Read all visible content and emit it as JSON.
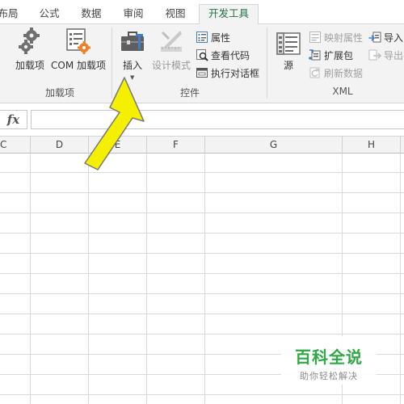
{
  "tabs": [
    {
      "label": "布局"
    },
    {
      "label": "公式"
    },
    {
      "label": "数据"
    },
    {
      "label": "审阅"
    },
    {
      "label": "视图"
    },
    {
      "label": "开发工具",
      "active": true
    }
  ],
  "ribbon": {
    "addins_group": {
      "label": "加载项",
      "addins_button": "加载项",
      "com_addins_button": "COM 加载项"
    },
    "controls_group": {
      "label": "控件",
      "insert_button": "插入",
      "design_mode_button": "设计模式",
      "properties_button": "属性",
      "view_code_button": "查看代码",
      "run_dialog_button": "执行对话框"
    },
    "xml_group": {
      "label": "XML",
      "source_button": "源",
      "map_properties_button": "映射属性",
      "expansion_pack_button": "扩展包",
      "refresh_data_button": "刷新数据",
      "import_button": "导入",
      "export_button": "导出"
    }
  },
  "formula_bar": {
    "fx_label": "fx",
    "value": ""
  },
  "columns": [
    "C",
    "D",
    "E",
    "F",
    "G",
    "H"
  ],
  "watermark": {
    "title": "百科全说",
    "subtitle": "助你轻松解决"
  },
  "colors": {
    "accent": "#217346",
    "arrow_fill": "#f4f000",
    "watermark_green": "#2da843"
  },
  "icons": [
    "gear-icon",
    "com-addin-icon",
    "toolbox-icon",
    "design-mode-icon",
    "properties-icon",
    "view-code-icon",
    "dialog-icon",
    "xml-source-icon",
    "map-properties-icon",
    "expansion-pack-icon",
    "refresh-data-icon",
    "import-icon",
    "export-icon",
    "fx-icon",
    "arrow-annotation"
  ]
}
